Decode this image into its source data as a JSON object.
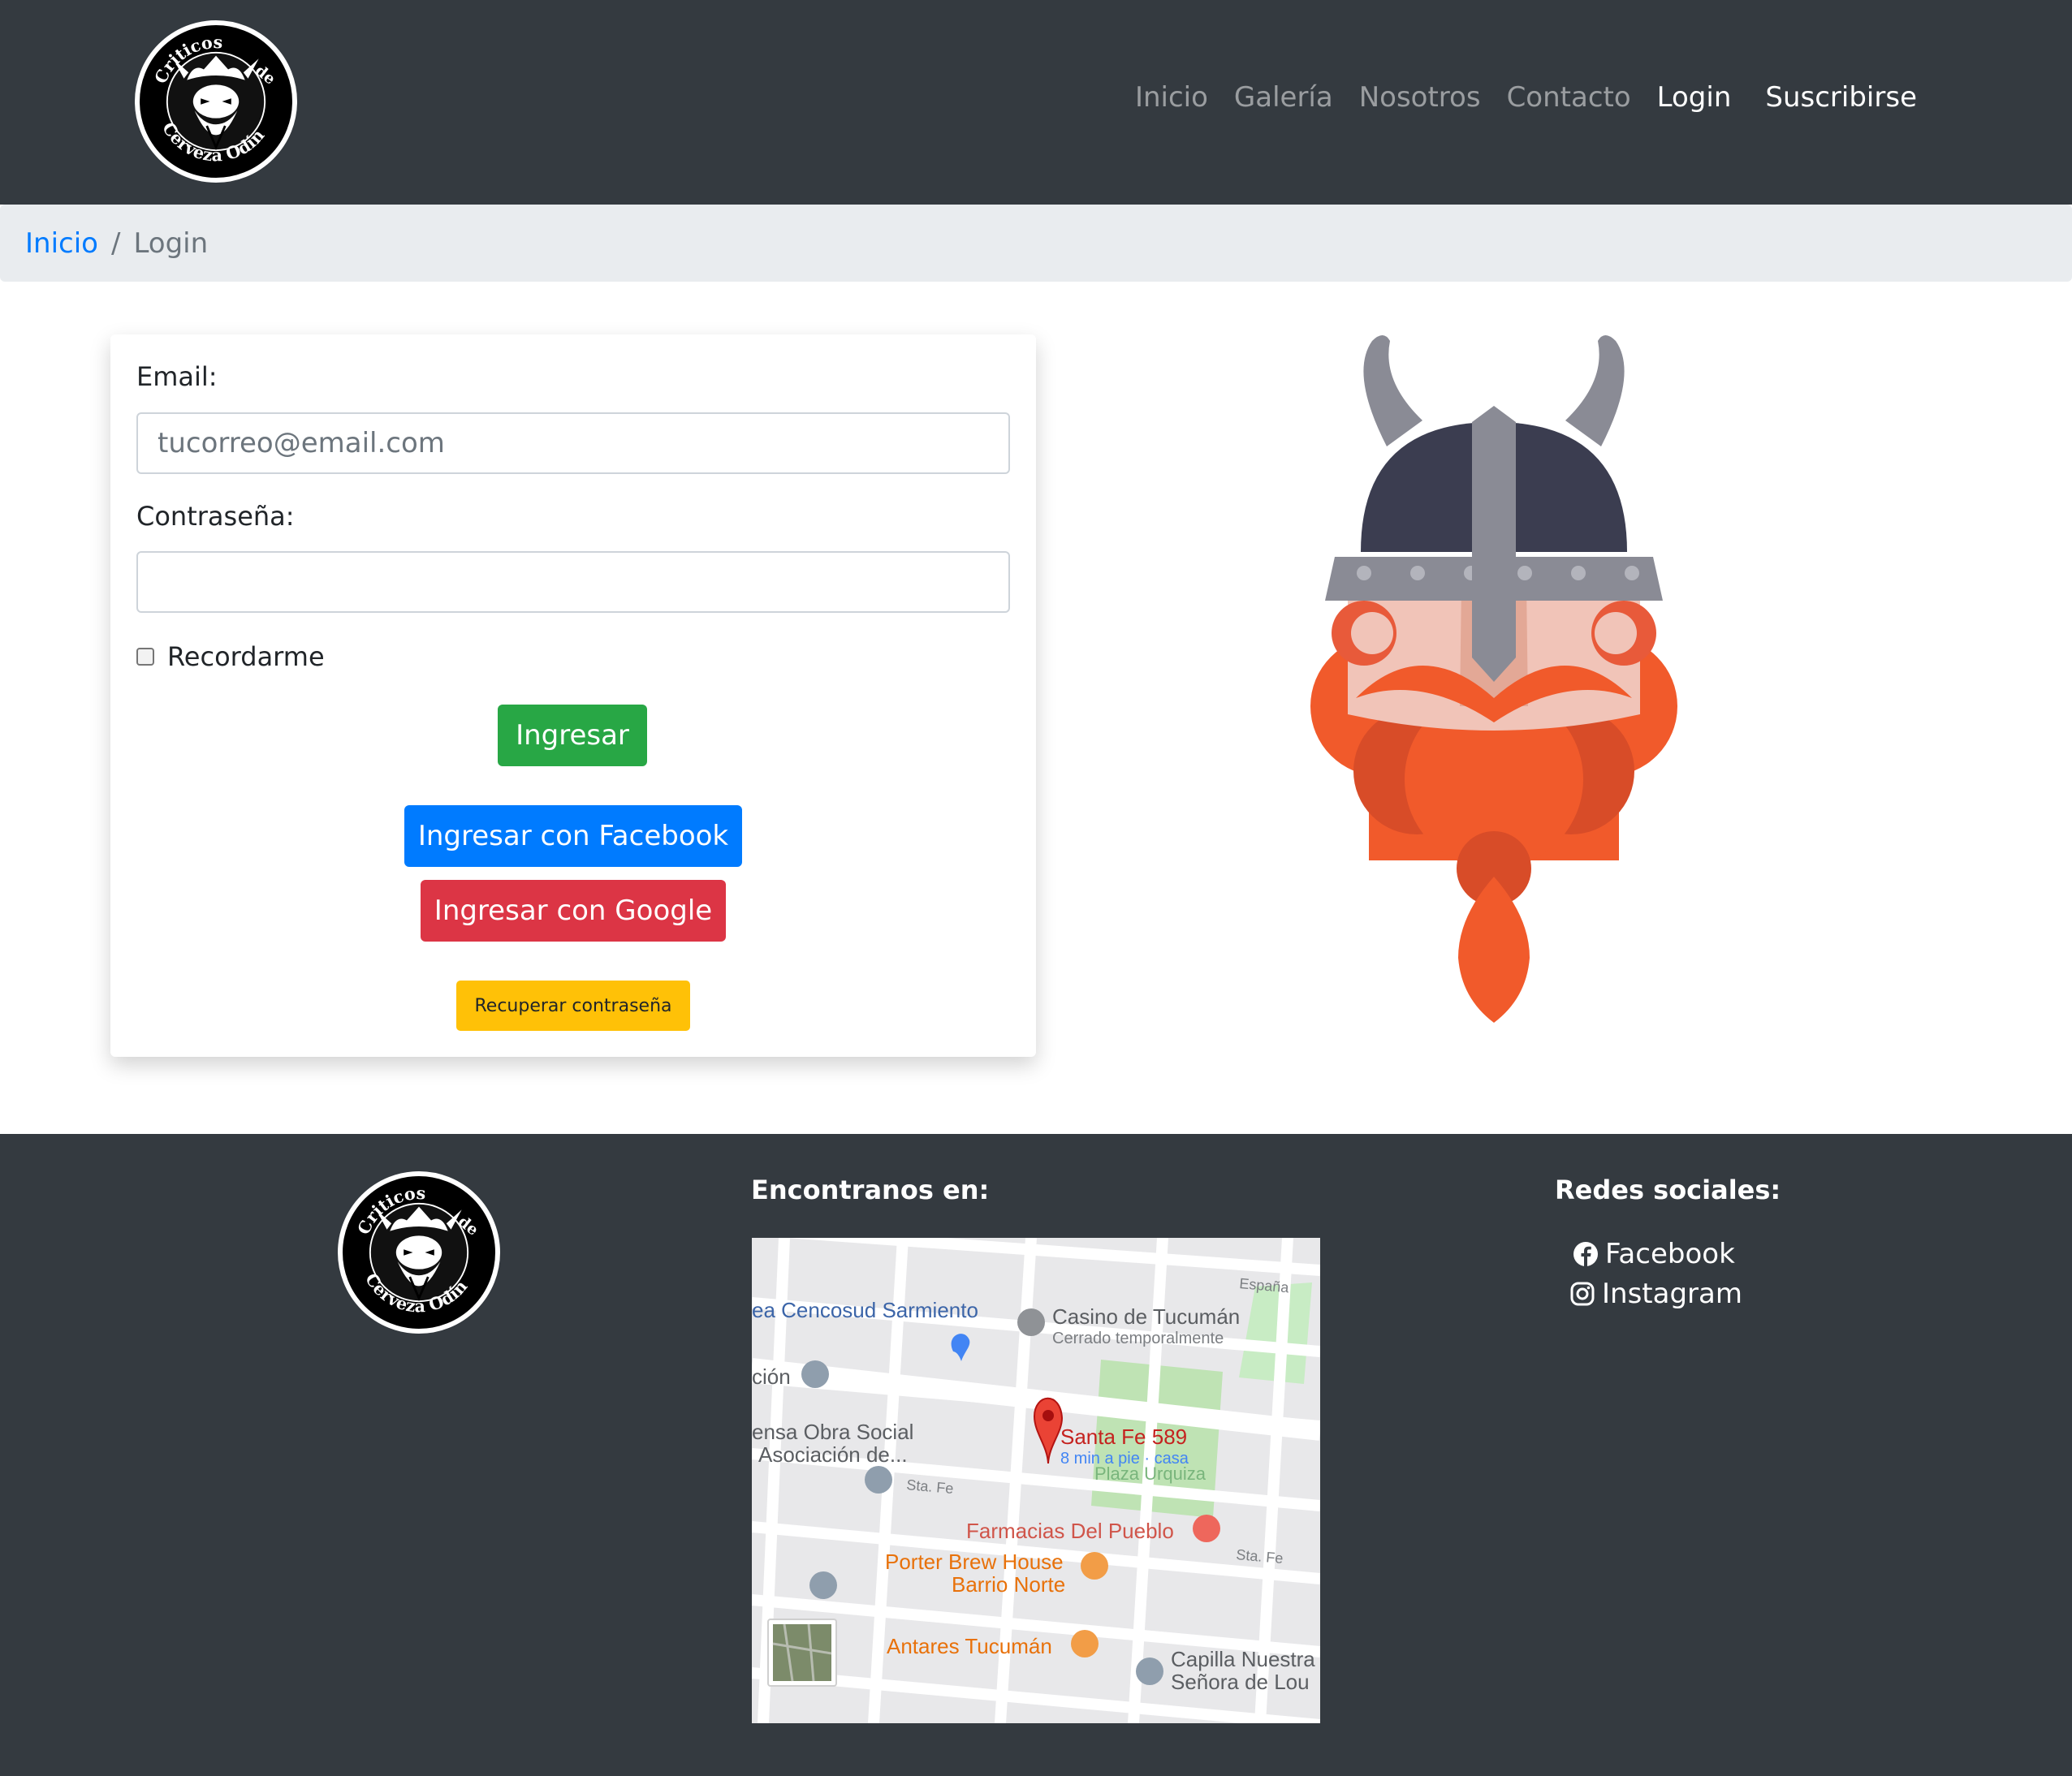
{
  "logo": {
    "top_text": "Criticos",
    "right_text": "de",
    "bottom_text": "Cerveza Odín"
  },
  "navbar": {
    "links": [
      {
        "label": "Inicio"
      },
      {
        "label": "Galería"
      },
      {
        "label": "Nosotros"
      },
      {
        "label": "Contacto"
      },
      {
        "label": "Login"
      },
      {
        "label": "Suscribirse"
      }
    ],
    "active": "Login"
  },
  "breadcrumb": {
    "home": "Inicio",
    "separator": "/",
    "current": "Login"
  },
  "login": {
    "email_label": "Email:",
    "email_placeholder": "tucorreo@email.com",
    "email_value": "",
    "password_label": "Contraseña:",
    "password_value": "",
    "remember_label": "Recordarme",
    "remember_checked": false,
    "submit_label": "Ingresar",
    "facebook_label": "Ingresar con Facebook",
    "google_label": "Ingresar con Google",
    "recover_label": "Recuperar contraseña"
  },
  "footer": {
    "map_title": "Encontranos en:",
    "social_title": "Redes sociales:",
    "social": [
      {
        "label": "Facebook",
        "icon": "facebook-icon"
      },
      {
        "label": "Instagram",
        "icon": "instagram-icon"
      }
    ]
  },
  "map": {
    "pin_title": "Santa Fe 589",
    "pin_subtitle": "8 min a pie · casa",
    "labels": {
      "cencosud": "ea Cencosud Sarmiento",
      "casino": "Casino de Tucumán",
      "casino_status": "Cerrado temporalmente",
      "espana": "España",
      "cion": "ción",
      "obra_social_1": "ensa Obra Social",
      "obra_social_2": "Asociación de...",
      "sta_fe_1": "Sta. Fe",
      "sta_fe_2": "Sta. Fe",
      "plaza": "Plaza Urquiza",
      "farmacias": "Farmacias Del Pueblo",
      "porter_1": "Porter Brew House",
      "porter_2": "Barrio Norte",
      "antares": "Antares Tucumán",
      "capilla_1": "Capilla Nuestra",
      "capilla_2": "Señora de Lou"
    }
  },
  "colors": {
    "navbar_bg": "#343a40",
    "breadcrumb_bg": "#e9ecef",
    "link_blue": "#007bff",
    "success_green": "#28a745",
    "danger_red": "#dc3545",
    "warning_yellow": "#ffc107",
    "beard_orange": "#f15a2b",
    "helmet_dark": "#3b3d50",
    "helmet_grey": "#8a8b95"
  }
}
